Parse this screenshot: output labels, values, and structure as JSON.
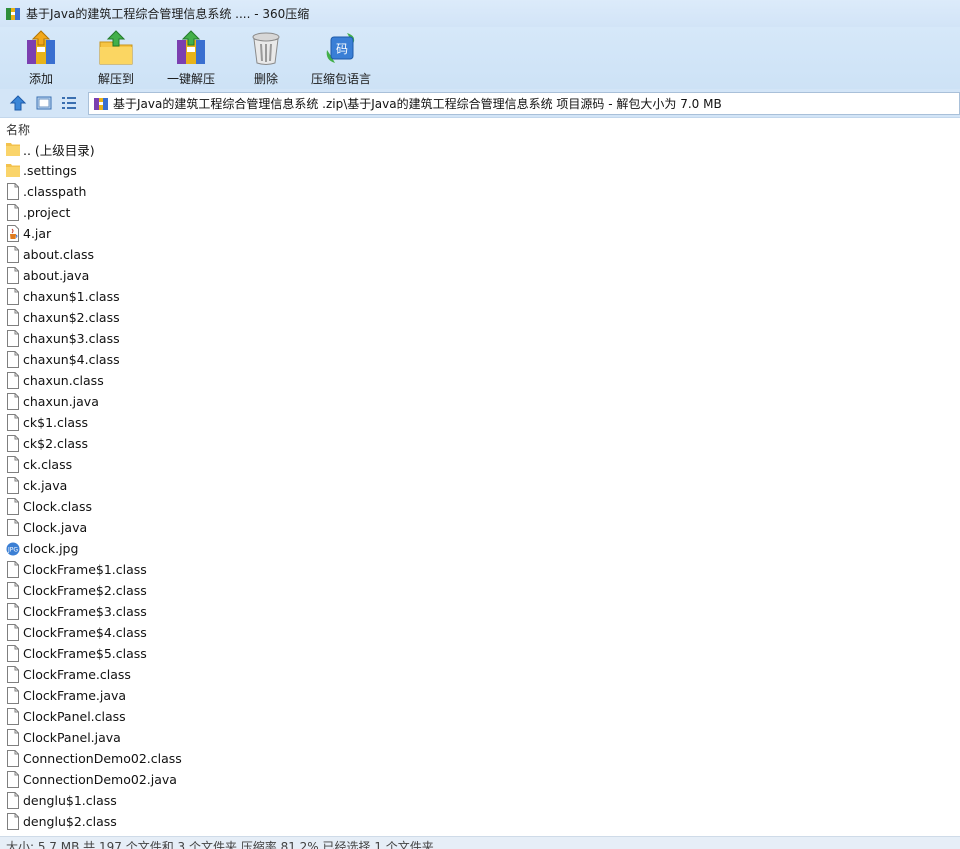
{
  "window": {
    "title": "基于Java的建筑工程综合管理信息系统 .... - 360压缩"
  },
  "toolbar": {
    "buttons": [
      {
        "label": "添加",
        "icon": "add-archive-icon"
      },
      {
        "label": "解压到",
        "icon": "extract-to-icon"
      },
      {
        "label": "一键解压",
        "icon": "one-click-extract-icon"
      },
      {
        "label": "删除",
        "icon": "delete-icon"
      },
      {
        "label": "压缩包语言",
        "icon": "archive-language-icon"
      }
    ]
  },
  "address": {
    "path": "基于Java的建筑工程综合管理信息系统 .zip\\基于Java的建筑工程综合管理信息系统 项目源码 - 解包大小为 7.0 MB"
  },
  "list": {
    "column_header": "名称",
    "items": [
      {
        "name": ".. (上级目录)",
        "type": "folder"
      },
      {
        "name": ".settings",
        "type": "folder"
      },
      {
        "name": ".classpath",
        "type": "file"
      },
      {
        "name": ".project",
        "type": "file"
      },
      {
        "name": "4.jar",
        "type": "jar"
      },
      {
        "name": "about.class",
        "type": "file"
      },
      {
        "name": "about.java",
        "type": "file"
      },
      {
        "name": "chaxun$1.class",
        "type": "file"
      },
      {
        "name": "chaxun$2.class",
        "type": "file"
      },
      {
        "name": "chaxun$3.class",
        "type": "file"
      },
      {
        "name": "chaxun$4.class",
        "type": "file"
      },
      {
        "name": "chaxun.class",
        "type": "file"
      },
      {
        "name": "chaxun.java",
        "type": "file"
      },
      {
        "name": "ck$1.class",
        "type": "file"
      },
      {
        "name": "ck$2.class",
        "type": "file"
      },
      {
        "name": "ck.class",
        "type": "file"
      },
      {
        "name": "ck.java",
        "type": "file"
      },
      {
        "name": "Clock.class",
        "type": "file"
      },
      {
        "name": "Clock.java",
        "type": "file"
      },
      {
        "name": "clock.jpg",
        "type": "image"
      },
      {
        "name": "ClockFrame$1.class",
        "type": "file"
      },
      {
        "name": "ClockFrame$2.class",
        "type": "file"
      },
      {
        "name": "ClockFrame$3.class",
        "type": "file"
      },
      {
        "name": "ClockFrame$4.class",
        "type": "file"
      },
      {
        "name": "ClockFrame$5.class",
        "type": "file"
      },
      {
        "name": "ClockFrame.class",
        "type": "file"
      },
      {
        "name": "ClockFrame.java",
        "type": "file"
      },
      {
        "name": "ClockPanel.class",
        "type": "file"
      },
      {
        "name": "ClockPanel.java",
        "type": "file"
      },
      {
        "name": "ConnectionDemo02.class",
        "type": "file"
      },
      {
        "name": "ConnectionDemo02.java",
        "type": "file"
      },
      {
        "name": "denglu$1.class",
        "type": "file"
      },
      {
        "name": "denglu$2.class",
        "type": "file"
      }
    ]
  },
  "status": {
    "text": "大小: 5.7 MB 共 197 个文件和 3 个文件夹 压缩率 81.2% 已经选择 1 个文件夹"
  }
}
